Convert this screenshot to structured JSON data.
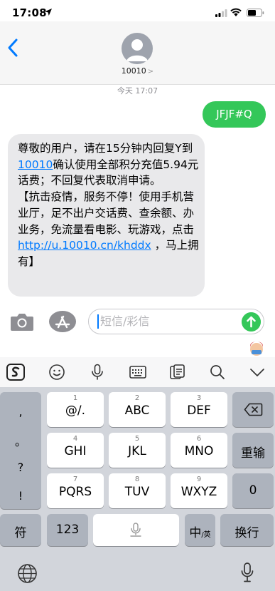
{
  "status_bar": {
    "time": "17:08"
  },
  "header": {
    "back_label": "<",
    "contact": "10010",
    "contact_chevron": ">"
  },
  "conversation": {
    "timestamp": "今天 17:07",
    "sent_message": "JFJF#Q",
    "received_message": {
      "part1": "尊敬的用户，请在15分钟内回复Y到",
      "link_number": "10010",
      "part2": "确认使用全部积分充值5.94元话费；不回复代表取消申请。\n【抗击疫情，服务不停！使用手机营业厅，足不出户交话费、查余额、办业务，免流量看电影、玩游戏，点击 ",
      "link_url": "http://u.10010.cn/khddx",
      "part3": " ，马上拥有】"
    }
  },
  "input_bar": {
    "placeholder": "短信/彩信"
  },
  "keyboard": {
    "toolbar_icons": [
      "sogou-logo-icon",
      "emoji-icon",
      "microphone-icon",
      "keyboard-icon",
      "clipboard-icon",
      "search-icon",
      "collapse-icon"
    ],
    "left_column": [
      ",",
      "。",
      "?",
      "!"
    ],
    "keys": [
      {
        "num": "1",
        "label": "@/."
      },
      {
        "num": "2",
        "label": "ABC"
      },
      {
        "num": "3",
        "label": "DEF"
      },
      {
        "num": "4",
        "label": "GHI"
      },
      {
        "num": "5",
        "label": "JKL"
      },
      {
        "num": "6",
        "label": "MNO"
      },
      {
        "num": "7",
        "label": "PQRS"
      },
      {
        "num": "8",
        "label": "TUV"
      },
      {
        "num": "9",
        "label": "WXYZ"
      }
    ],
    "delete_icon": "backspace-icon",
    "retype_label": "重输",
    "zero_label": "0",
    "symbol_label": "符",
    "num_label": "123",
    "lang_label_main": "中",
    "lang_label_sub": "/英",
    "return_label": "换行",
    "globe_icon": "globe-icon",
    "dictation_icon": "microphone-icon"
  },
  "colors": {
    "imessage_green": "#34c759",
    "link_blue": "#007aff",
    "received_bubble": "#e9e9eb"
  }
}
